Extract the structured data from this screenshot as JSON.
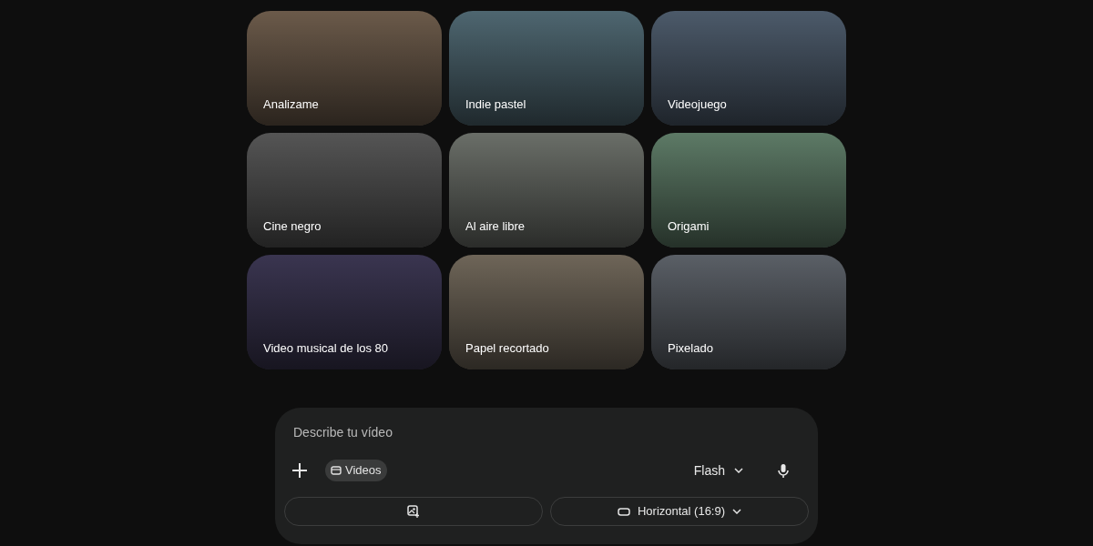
{
  "style_cards": [
    {
      "label": "Analizame"
    },
    {
      "label": "Indie pastel"
    },
    {
      "label": "Videojuego"
    },
    {
      "label": "Cine negro"
    },
    {
      "label": "Al aire libre"
    },
    {
      "label": "Origami"
    },
    {
      "label": "Video musical de los 80"
    },
    {
      "label": "Papel recortado"
    },
    {
      "label": "Pixelado"
    }
  ],
  "prompt": {
    "placeholder": "Describe tu vídeo",
    "tool_chip": "Videos",
    "model": "Flash",
    "aspect_ratio": "Horizontal (16:9)"
  }
}
